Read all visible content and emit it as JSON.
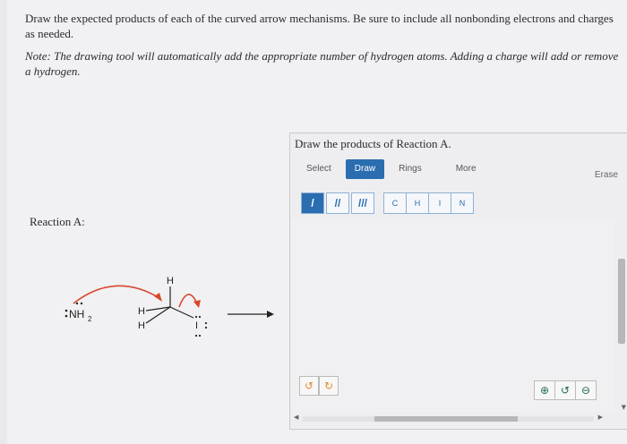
{
  "prompt": {
    "instruction": "Draw the expected products of each of the curved arrow mechanisms. Be sure to include all nonbonding electrons and charges as needed.",
    "note": "Note: The drawing tool will automatically add the appropriate number of hydrogen atoms. Adding a charge will add or remove a hydrogen."
  },
  "reaction": {
    "label": "Reaction A:",
    "nucleophile": "NH",
    "nucleophile_sub": "2",
    "atoms": {
      "h_top": "H",
      "h_left": "H",
      "h_bottom": "H",
      "leaving": "I"
    }
  },
  "panel": {
    "title": "Draw the products of Reaction A.",
    "tabs": [
      "Select",
      "Draw",
      "Rings",
      "More"
    ],
    "active_tab": "Draw",
    "erase": "Erase",
    "bonds": [
      "/",
      "//",
      "///"
    ],
    "atoms": [
      "C",
      "H",
      "I",
      "N"
    ]
  },
  "icons": {
    "undo": "undo-icon",
    "redo": "redo-icon",
    "zoom_in": "zoom-in-icon",
    "reset": "reset-icon",
    "zoom_out": "zoom-out-icon"
  },
  "colors": {
    "accent": "#2a6db0",
    "arrow": "#d9472b"
  }
}
